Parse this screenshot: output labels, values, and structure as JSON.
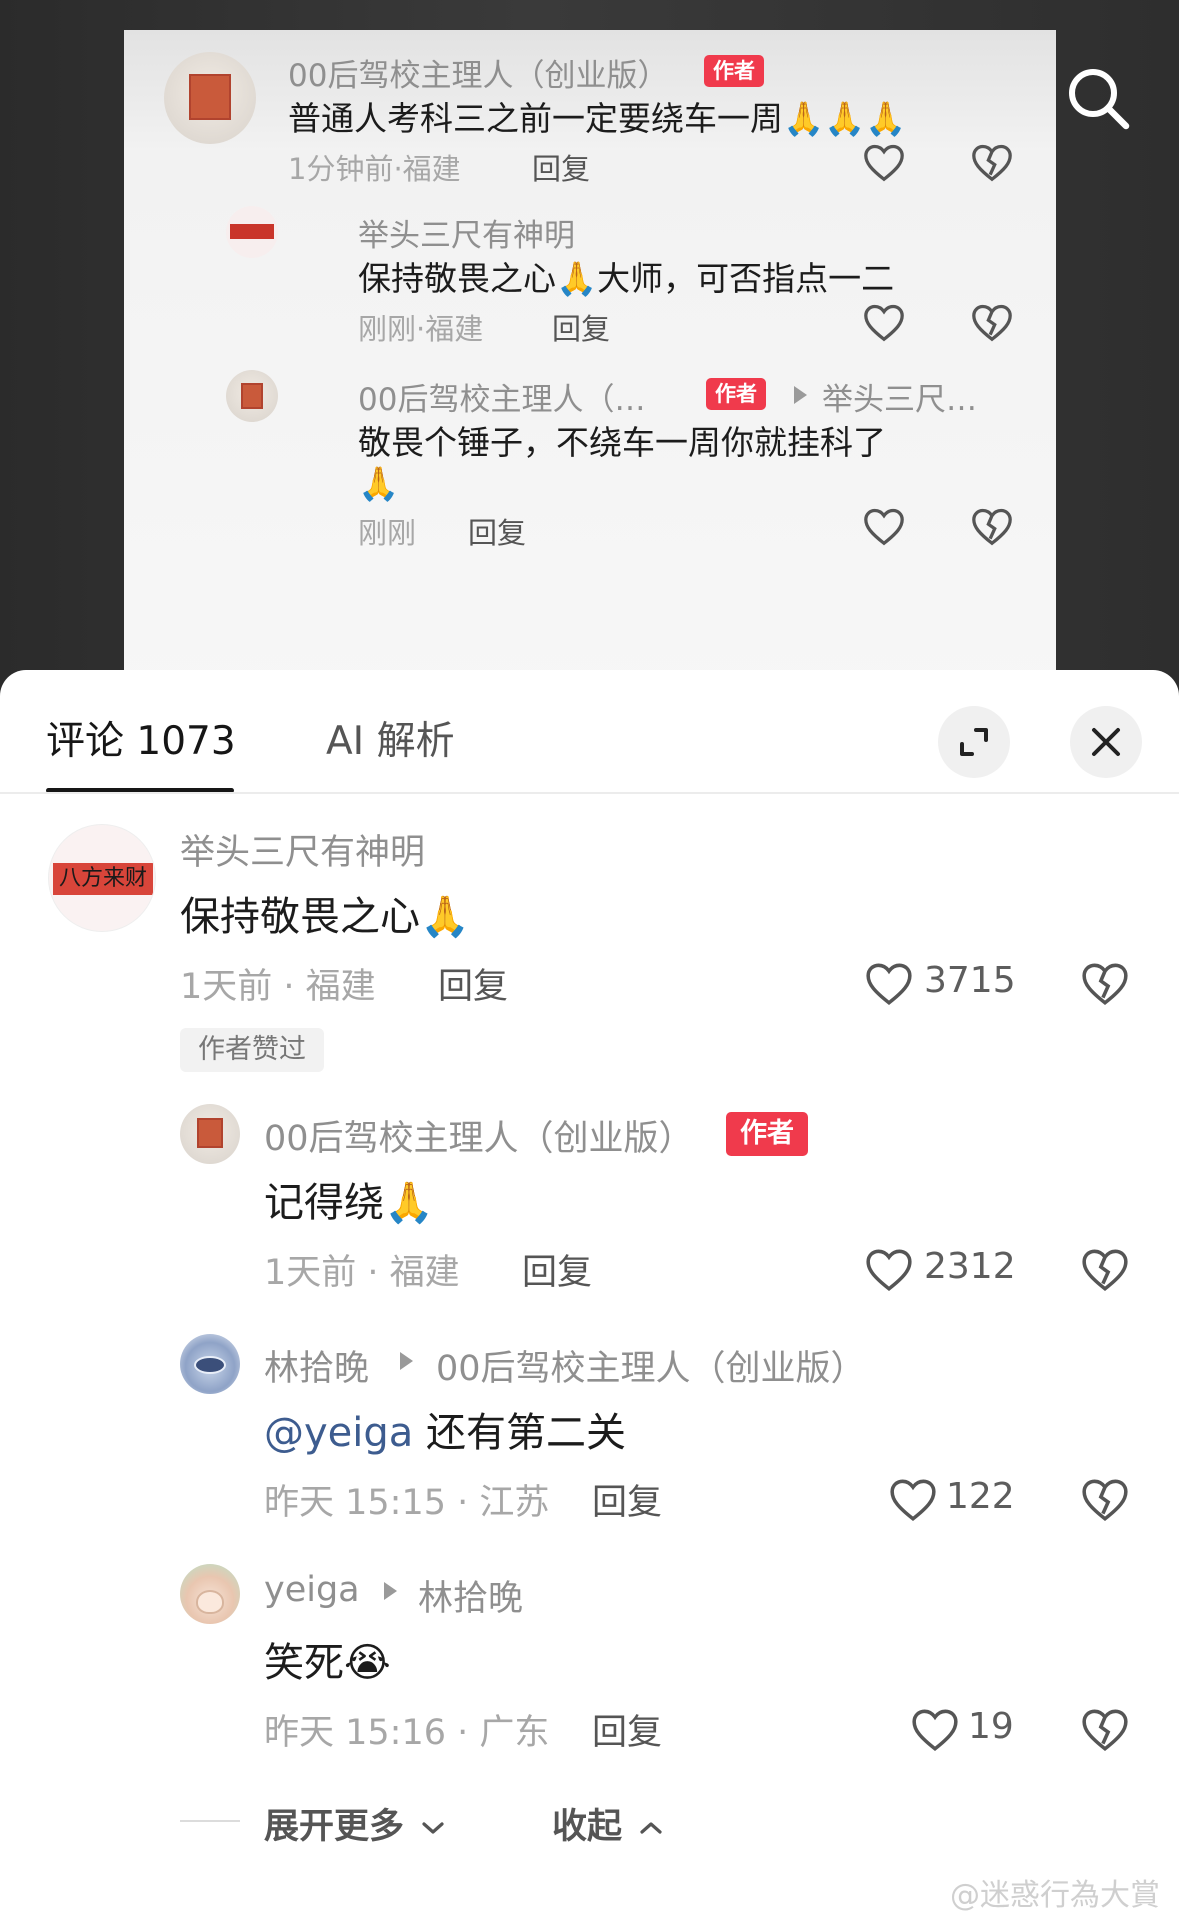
{
  "top_card": {
    "comment": {
      "name": "00后驾校主理人（创业版）",
      "tag": "作者",
      "text": "普通人考科三之前一定要绕车一周🙏🙏🙏",
      "meta": "1分钟前·福建",
      "reply": "回复"
    },
    "reply1": {
      "name": "举头三尺有神明",
      "text": "保持敬畏之心🙏大师，可否指点一二",
      "meta": "刚刚·福建",
      "reply": "回复"
    },
    "reply2": {
      "name": "00后驾校主理人（…",
      "tag": "作者",
      "target": "举头三尺…",
      "text_line1": "敬畏个锤子，不绕车一周你就挂科了",
      "text_line2": "🙏",
      "meta": "刚刚",
      "reply": "回复"
    }
  },
  "sheet": {
    "tab_comments": "评论 1073",
    "tab_ai": "AI 解析",
    "comments": [
      {
        "name": "举头三尺有神明",
        "text": "保持敬畏之心🙏",
        "meta": "1天前 · 福建",
        "reply": "回复",
        "likes": "3715",
        "badge": "作者赞过"
      },
      {
        "name": "00后驾校主理人（创业版）",
        "tag": "作者",
        "text": "记得绕🙏",
        "meta": "1天前 · 福建",
        "reply": "回复",
        "likes": "2312"
      },
      {
        "name": "林拾晚",
        "target": "00后驾校主理人（创业版）",
        "mention": "@yeiga",
        "text": "还有第二关",
        "meta": "昨天 15:15 · 江苏",
        "reply": "回复",
        "likes": "122"
      },
      {
        "name": "yeiga",
        "target": "林拾晚",
        "text": "笑死😭",
        "meta": "昨天 15:16 · 广东",
        "reply": "回复",
        "likes": "19"
      }
    ],
    "expand_more": "展开更多",
    "collapse": "收起",
    "avatar_text": "八方来财"
  },
  "watermark": "@迷惑行為大賞",
  "colors": {
    "author_tag": "#f03a4c",
    "mention": "#3d5c8f"
  }
}
